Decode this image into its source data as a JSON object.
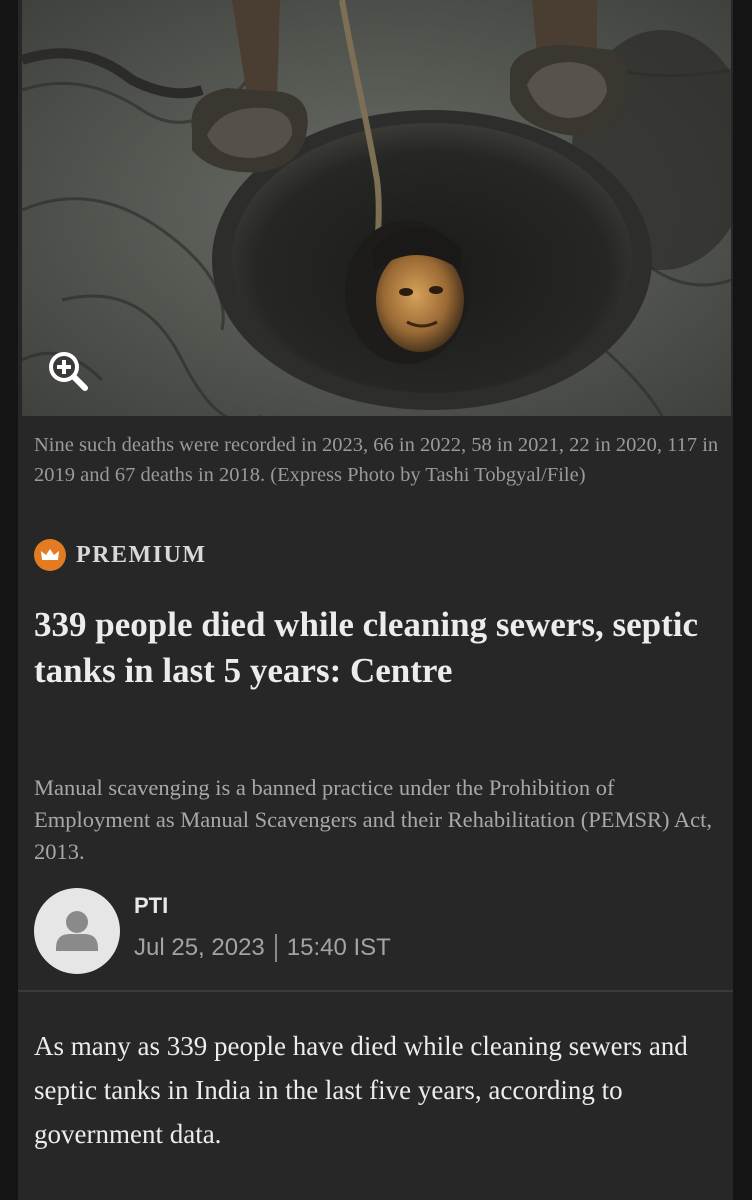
{
  "photo": {
    "alt_icon": "zoom-in-icon"
  },
  "caption": "Nine such deaths were recorded in 2023, 66 in 2022, 58 in 2021, 22 in 2020, 117 in 2019 and 67 deaths in 2018. (Express Photo by Tashi Tobgyal/File)",
  "premium": {
    "label": "PREMIUM",
    "icon": "crown-icon",
    "color": "#e27b22"
  },
  "headline": "339 people died while cleaning sewers, septic tanks in last 5 years: Centre",
  "standfirst": "Manual scavenging is a banned practice under the Prohibition of Employment as Manual Scavengers and their Rehabilitation (PEMSR) Act, 2013.",
  "author": {
    "name": "PTI",
    "date": "Jul 25, 2023",
    "time": "15:40 IST",
    "avatar_icon": "default-user-icon"
  },
  "body": {
    "paragraph1": "As many as 339 people have died while cleaning sewers and septic tanks in India in the last five years, according to government data."
  }
}
